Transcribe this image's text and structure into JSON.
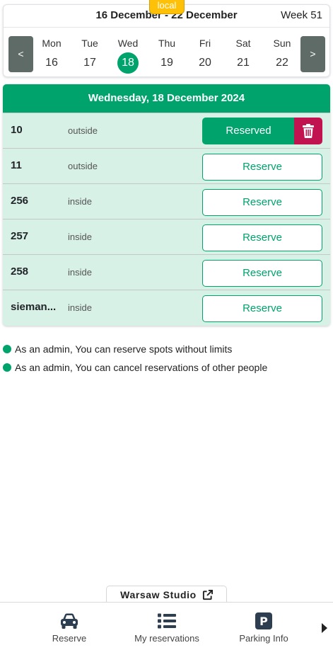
{
  "env_badge": "local",
  "week": {
    "range": "16 December - 22 December",
    "week_label": "Week 51",
    "prev_label": "<",
    "next_label": ">",
    "days": [
      {
        "name": "Mon",
        "num": "16"
      },
      {
        "name": "Tue",
        "num": "17"
      },
      {
        "name": "Wed",
        "num": "18"
      },
      {
        "name": "Thu",
        "num": "19"
      },
      {
        "name": "Fri",
        "num": "20"
      },
      {
        "name": "Sat",
        "num": "21"
      },
      {
        "name": "Sun",
        "num": "22"
      }
    ],
    "selected_day": "Wed"
  },
  "spots": {
    "date_title": "Wednesday, 18 December 2024",
    "rows": [
      {
        "name": "10",
        "type": "outside",
        "action": "Reserved",
        "reserved": true
      },
      {
        "name": "11",
        "type": "outside",
        "action": "Reserve"
      },
      {
        "name": "256",
        "type": "inside",
        "action": "Reserve"
      },
      {
        "name": "257",
        "type": "inside",
        "action": "Reserve"
      },
      {
        "name": "258",
        "type": "inside",
        "action": "Reserve"
      },
      {
        "name": "sieman...",
        "type": "inside",
        "action": "Reserve"
      }
    ]
  },
  "notes": [
    "As an admin, You can reserve spots without limits",
    "As an admin, You can cancel reservations of other people"
  ],
  "studio": {
    "name": "Warsaw Studio",
    "icon": "external-link-icon"
  },
  "bottom_nav": {
    "reserve": "Reserve",
    "my_reservations": "My reservations",
    "parking_info": "Parking Info",
    "parking_icon_letter": "P"
  },
  "colors": {
    "accent": "#00a36c",
    "delete": "#c0134f",
    "row_bg": "#d8f1e6",
    "nav_button": "#5f6b67",
    "badge": "#ffc107"
  }
}
